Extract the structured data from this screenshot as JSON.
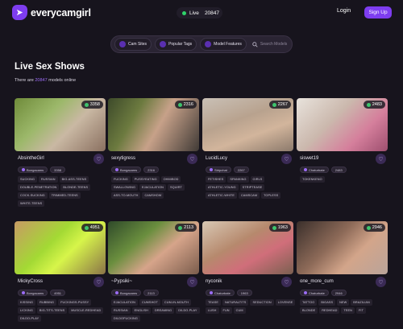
{
  "header": {
    "logo_text": "everycamgirl",
    "live_label": "Live",
    "live_count": "20847",
    "login_label": "Login",
    "signup_label": "Sign Up"
  },
  "filters": {
    "cam_sites": "Cam Sites",
    "popular_tags": "Popular Tags",
    "model_features": "Model Features",
    "search_placeholder": "Search Models"
  },
  "page": {
    "title": "Live Sex Shows",
    "sub_prefix": "There are ",
    "sub_count": "20847",
    "sub_suffix": " models online"
  },
  "cards": [
    {
      "name": "AbsintheGirl",
      "viewers": "3358",
      "site": "Bongacams",
      "count": "3358",
      "tags": [
        "SUCKING",
        "RUSSIAN",
        "BIG-ASS-TEENS",
        "DOUBLE-PENETRATION",
        "BLONDE-TEENS",
        "COCK-SUCKING",
        "TRIMMED-TEENS",
        "WHITE-TEENS"
      ]
    },
    {
      "name": "sexytigress",
      "viewers": "2316",
      "site": "Bongacams",
      "count": "2316",
      "tags": [
        "FUCKING",
        "PUSSYEATING",
        "OHMIBOD",
        "SWALLOWING",
        "EJACULATION",
        "SQUIRT",
        "ASS-TO-MOUTH",
        "CAMSHOW"
      ]
    },
    {
      "name": "LucidLucy",
      "viewers": "2267",
      "site": "Stripchat",
      "count": "2267",
      "tags": [
        "FETISHES",
        "SPANKING",
        "GIRLS",
        "ATHLETIC-YOUNG",
        "STRIPTEASE",
        "ATHLETIC-WHITE",
        "CAMSCAM",
        "TOPLESS"
      ]
    },
    {
      "name": "siswet19",
      "viewers": "2483",
      "site": "Chaturbate",
      "count": "2483",
      "tags": [
        "TOKENKENO"
      ]
    },
    {
      "name": "MickyCross",
      "viewers": "4951",
      "site": "Bongacams",
      "count": "4951",
      "tags": [
        "KISSING",
        "RUBBING",
        "FUCKINGS-PUSSY",
        "LICKING",
        "BIG-TITS-TEENS",
        "MUSCLE-REDHEAD",
        "DILDO-PLAY"
      ]
    },
    {
      "name": "~Pypsiki~",
      "viewers": "2113",
      "site": "Bongacams",
      "count": "2113",
      "tags": [
        "EJACULATION",
        "CUMSHOT",
        "CUM-IN-MOUTH",
        "RUSSIAN",
        "ENGLISH",
        "DREAMING",
        "DILDO-PLAY",
        "DILDOFUCKING"
      ]
    },
    {
      "name": "nyconik",
      "viewers": "1963",
      "site": "Chaturbate",
      "count": "1963",
      "tags": [
        "TEASE",
        "NATURALTITS",
        "SEDUCTION",
        "LOVENSE",
        "LUSH",
        "FUN",
        "CUM"
      ]
    },
    {
      "name": "one_more_cum",
      "viewers": "2946",
      "site": "Chaturbate",
      "count": "2946",
      "tags": [
        "TATTOO",
        "BIGASS",
        "NEW",
        "BRAZILIAN",
        "BLONDE",
        "REDHEAD",
        "TEEN",
        "FIT"
      ]
    }
  ],
  "colors": {
    "accent": "#7e3df0",
    "live": "#2fd36a",
    "background": "#17141d"
  }
}
